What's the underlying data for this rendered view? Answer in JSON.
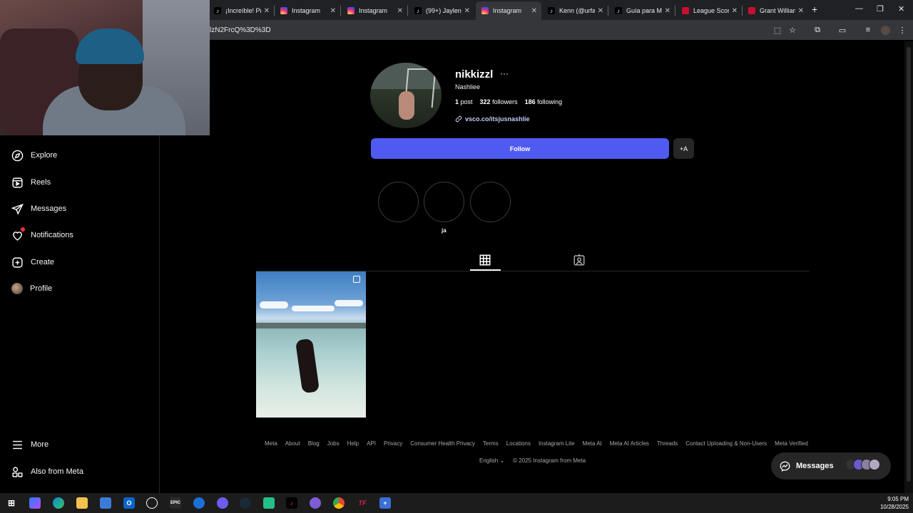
{
  "browser": {
    "tabs": [
      {
        "title": "¡Increíble! Pr",
        "icon": "tiktok-icon",
        "color": "#ffffff"
      },
      {
        "title": "Instagram",
        "icon": "instagram-icon",
        "color": "#e1306c"
      },
      {
        "title": "Instagram",
        "icon": "instagram-icon",
        "color": "#e1306c"
      },
      {
        "title": "(99+) Jaylen",
        "icon": "tiktok-icon",
        "color": "#ffffff"
      },
      {
        "title": "Instagram",
        "icon": "instagram-icon",
        "color": "#e1306c",
        "active": true
      },
      {
        "title": "Kenn (@urfa",
        "icon": "tiktok-icon",
        "color": "#ffffff"
      },
      {
        "title": "Guía para M",
        "icon": "tiktok-icon",
        "color": "#ffffff"
      },
      {
        "title": "League Scor",
        "icon": "league-icon",
        "color": "#c8102e"
      },
      {
        "title": "Grant William",
        "icon": "league-icon",
        "color": "#c8102e"
      }
    ],
    "url": "lzN2FrcQ%3D%3D"
  },
  "sidebar": {
    "items": [
      {
        "label": "Explore",
        "icon": "compass-icon"
      },
      {
        "label": "Reels",
        "icon": "reels-icon"
      },
      {
        "label": "Messages",
        "icon": "paper-plane-icon"
      },
      {
        "label": "Notifications",
        "icon": "heart-icon",
        "badge": true
      },
      {
        "label": "Create",
        "icon": "plus-square-icon"
      },
      {
        "label": "Profile",
        "icon": "avatar"
      }
    ],
    "more": "More",
    "also_from_meta": "Also from Meta"
  },
  "profile": {
    "username": "nikkizzl",
    "full_name": "Nashliee",
    "posts_count": "1",
    "posts_label": "post",
    "followers_count": "322",
    "followers_label": "followers",
    "following_count": "186",
    "following_label": "following",
    "link": "vsco.co/itsjusnashlie",
    "follow_label": "Follow",
    "suggest_label": "+A"
  },
  "highlights": [
    {
      "label": ""
    },
    {
      "label": "ja"
    },
    {
      "label": ""
    }
  ],
  "tabs": [
    {
      "icon": "grid-icon",
      "active": true
    },
    {
      "icon": "tagged-icon",
      "active": false
    }
  ],
  "footer": {
    "links": [
      "Meta",
      "About",
      "Blog",
      "Jobs",
      "Help",
      "API",
      "Privacy",
      "Consumer Health Privacy",
      "Terms",
      "Locations",
      "Instagram Lite",
      "Meta AI",
      "Meta AI Articles",
      "Threads",
      "Contact Uploading & Non-Users",
      "Meta Verified"
    ],
    "language": "English",
    "copyright": "© 2025 Instagram from Meta"
  },
  "messages_pill": {
    "label": "Messages"
  },
  "taskbar": {
    "time": "9:05 PM",
    "date": "10/28/2025"
  },
  "colors": {
    "follow_blue": "#4f5bf0",
    "notif_red": "#ff3040"
  }
}
